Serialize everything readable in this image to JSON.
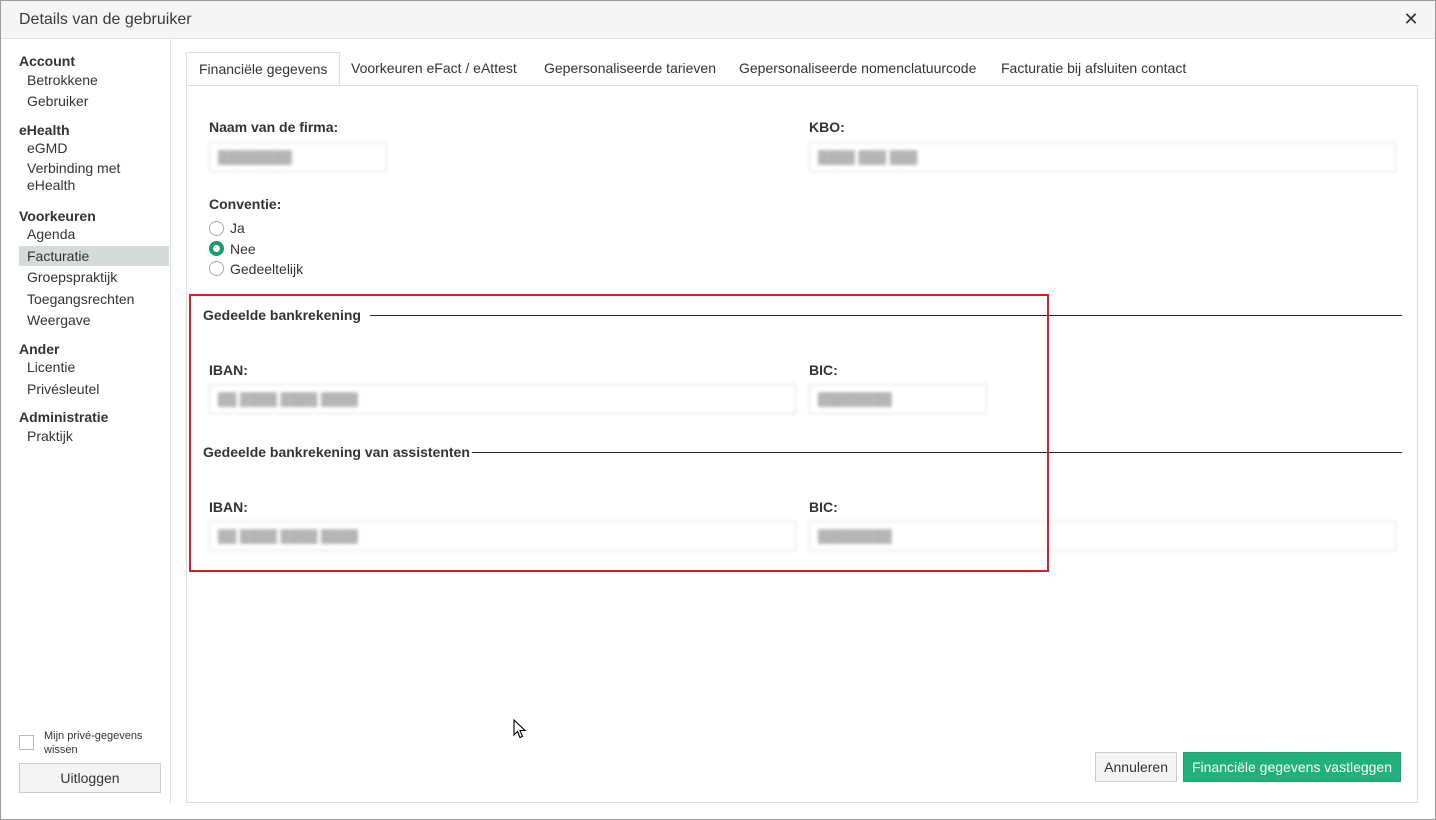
{
  "window": {
    "title": "Details van de gebruiker",
    "close_icon": "close-icon"
  },
  "sidebar": {
    "sections": [
      {
        "title": "Account",
        "items": [
          "Betrokkene",
          "Gebruiker"
        ]
      },
      {
        "title": "eHealth",
        "items": [
          "eGMD",
          "Verbinding met eHealth"
        ]
      },
      {
        "title": "Voorkeuren",
        "items": [
          "Agenda",
          "Facturatie",
          "Groepspraktijk",
          "Toegangsrechten",
          "Weergave"
        ]
      },
      {
        "title": "Ander",
        "items": [
          "Licentie",
          "Privésleutel"
        ]
      },
      {
        "title": "Administratie",
        "items": [
          "Praktijk"
        ]
      }
    ],
    "active_item": "Facturatie",
    "private_data_label": "Mijn privé-gegevens wissen",
    "logout_label": "Uitloggen"
  },
  "tabs": [
    "Financiële gegevens",
    "Voorkeuren eFact / eAttest",
    "Gepersonaliseerde tarieven",
    "Gepersonaliseerde nomenclatuurcode",
    "Facturatie bij afsluiten contact"
  ],
  "active_tab": "Financiële gegevens",
  "form": {
    "company_name_label": "Naam van de firma:",
    "company_name_value": "████████",
    "kbo_label": "KBO:",
    "kbo_value": "████ ███ ███",
    "convention_label": "Conventie:",
    "convention_options": [
      "Ja",
      "Nee",
      "Gedeeltelijk"
    ],
    "convention_selected": "Nee",
    "shared_account": {
      "title": "Gedeelde bankrekening",
      "iban_label": "IBAN:",
      "iban_value": "██ ████ ████ ████",
      "bic_label": "BIC:",
      "bic_value": "████████"
    },
    "assistants_account": {
      "title": "Gedeelde bankrekening van assistenten",
      "iban_label": "IBAN:",
      "iban_value": "██ ████ ████ ████",
      "bic_label": "BIC:",
      "bic_value": "████████"
    }
  },
  "buttons": {
    "cancel": "Annuleren",
    "save": "Financiële gegevens vastleggen"
  },
  "colors": {
    "accent": "#22b07d",
    "highlight": "#d61f2c",
    "active_item_bg": "#d5dbd8"
  }
}
